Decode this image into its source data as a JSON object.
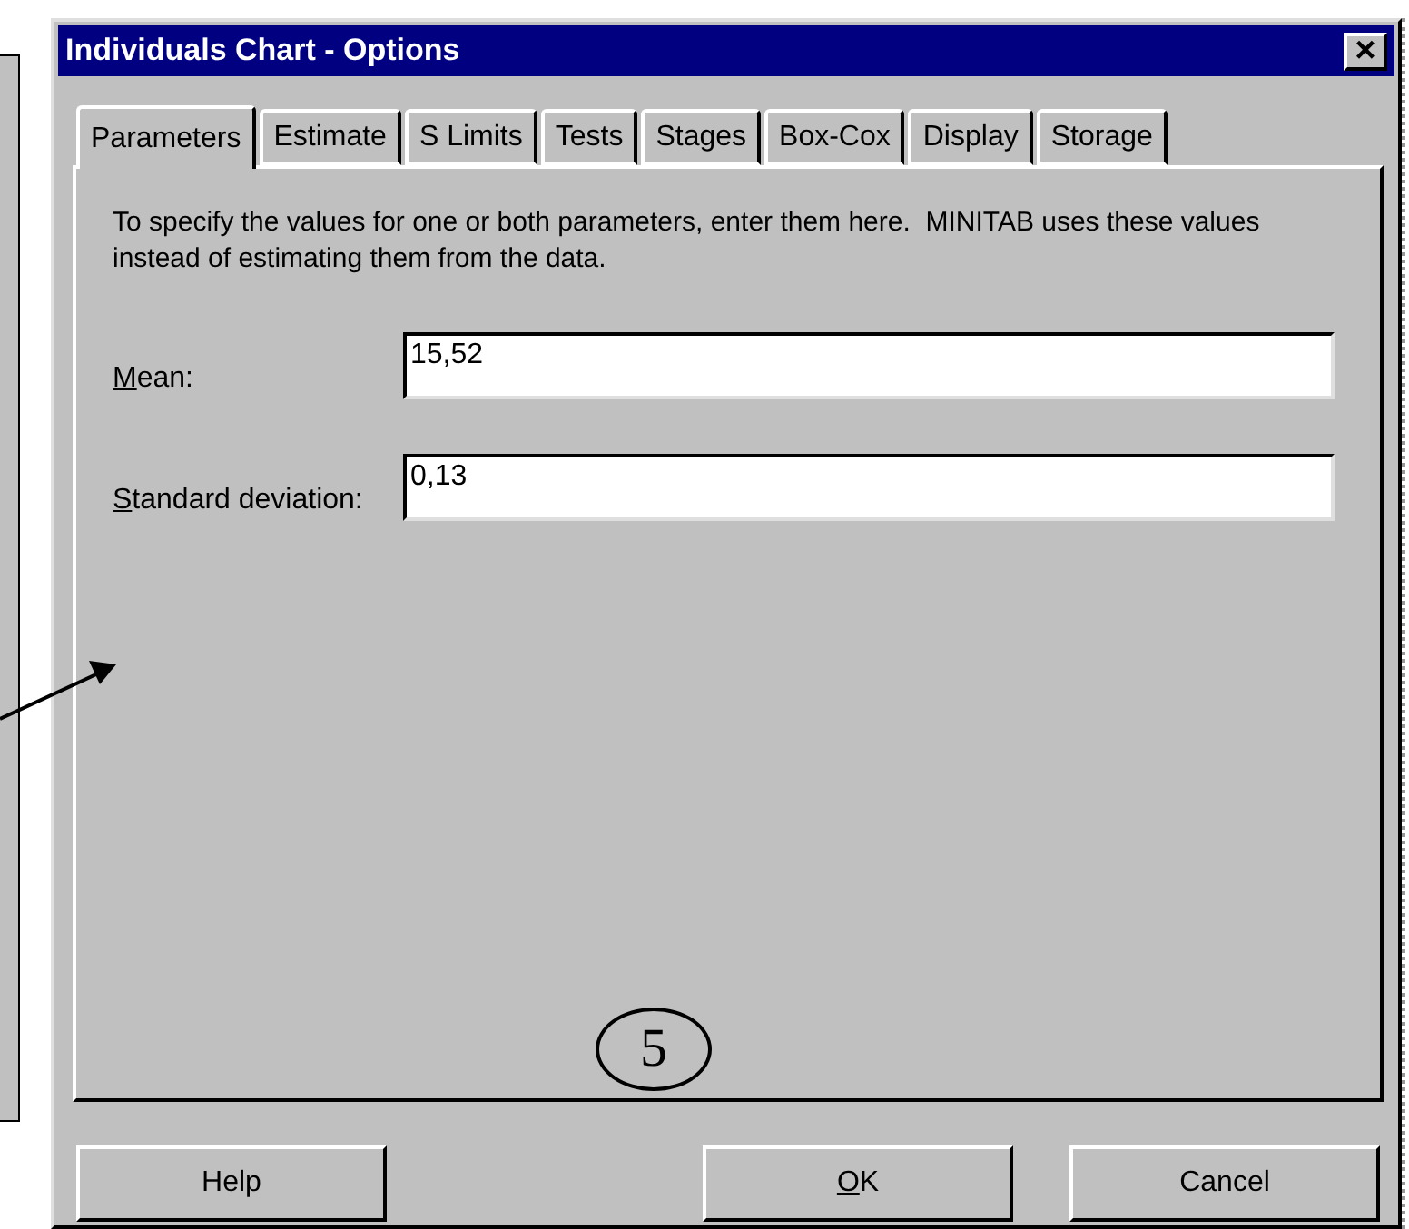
{
  "window": {
    "title": "Individuals Chart - Options",
    "close": "×"
  },
  "tabs": [
    {
      "label": "Parameters",
      "selected": true
    },
    {
      "label": "Estimate",
      "selected": false
    },
    {
      "label": "S Limits",
      "selected": false
    },
    {
      "label": "Tests",
      "selected": false
    },
    {
      "label": "Stages",
      "selected": false
    },
    {
      "label": "Box-Cox",
      "selected": false
    },
    {
      "label": "Display",
      "selected": false
    },
    {
      "label": "Storage",
      "selected": false
    }
  ],
  "description": "To specify the values for one or both parameters, enter them here.  MINITAB uses these values instead of estimating them from the data.",
  "fields": [
    {
      "label_key": "M",
      "label_rest": "ean:",
      "value": "15,52"
    },
    {
      "label_key": "S",
      "label_rest": "tandard deviation:",
      "value": "0,13"
    }
  ],
  "buttons": [
    {
      "label_rest": "Help"
    },
    {
      "label_key": "O",
      "label_rest": "K"
    },
    {
      "label_rest": "Cancel"
    }
  ],
  "annotation": {
    "number": "5"
  }
}
